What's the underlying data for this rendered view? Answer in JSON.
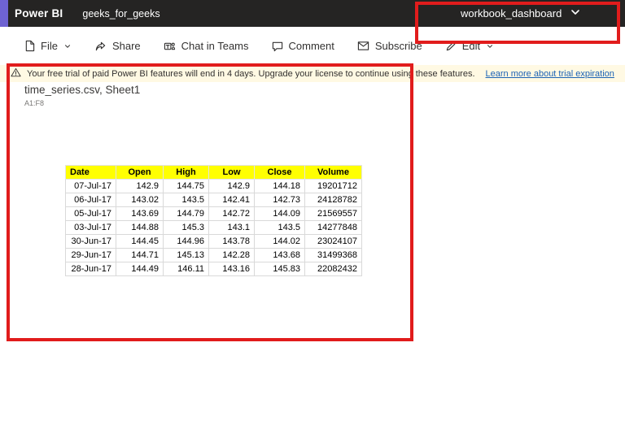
{
  "top_bar": {
    "brand": "Power BI",
    "workspace": "geeks_for_geeks",
    "dashboard_selector": "workbook_dashboard"
  },
  "toolbar": {
    "items": [
      {
        "label": "File",
        "icon": "file-icon",
        "has_chevron": true
      },
      {
        "label": "Share",
        "icon": "share-icon",
        "has_chevron": false
      },
      {
        "label": "Chat in Teams",
        "icon": "teams-icon",
        "has_chevron": false
      },
      {
        "label": "Comment",
        "icon": "comment-icon",
        "has_chevron": false
      },
      {
        "label": "Subscribe",
        "icon": "subscribe-icon",
        "has_chevron": false
      },
      {
        "label": "Edit",
        "icon": "edit-icon",
        "has_chevron": true
      }
    ]
  },
  "notification": {
    "icon": "warning-icon",
    "text": "Your free trial of paid Power BI features will end in 4 days. Upgrade your license to continue using these features.",
    "link": "Learn more about trial expiration"
  },
  "workbook": {
    "title": "time_series.csv, Sheet1",
    "range": "A1:F8",
    "table": {
      "headers": [
        "Date",
        "Open",
        "High",
        "Low",
        "Close",
        "Volume"
      ],
      "rows": [
        [
          "07-Jul-17",
          "142.9",
          "144.75",
          "142.9",
          "144.18",
          "19201712"
        ],
        [
          "06-Jul-17",
          "143.02",
          "143.5",
          "142.41",
          "142.73",
          "24128782"
        ],
        [
          "05-Jul-17",
          "143.69",
          "144.79",
          "142.72",
          "144.09",
          "21569557"
        ],
        [
          "03-Jul-17",
          "144.88",
          "145.3",
          "143.1",
          "143.5",
          "14277848"
        ],
        [
          "30-Jun-17",
          "144.45",
          "144.96",
          "143.78",
          "144.02",
          "23024107"
        ],
        [
          "29-Jun-17",
          "144.71",
          "145.13",
          "142.28",
          "143.68",
          "31499368"
        ],
        [
          "28-Jun-17",
          "144.49",
          "146.11",
          "143.16",
          "145.83",
          "22082432"
        ]
      ]
    }
  },
  "colors": {
    "top_bar_bg": "#252423",
    "corner_accent": "#6e63d2",
    "banner_bg": "#fff9e3",
    "table_header_bg": "#ffff00",
    "annotation_red": "#e11c1c",
    "link_blue": "#1b63b5",
    "toolbar_text": "#323130"
  }
}
